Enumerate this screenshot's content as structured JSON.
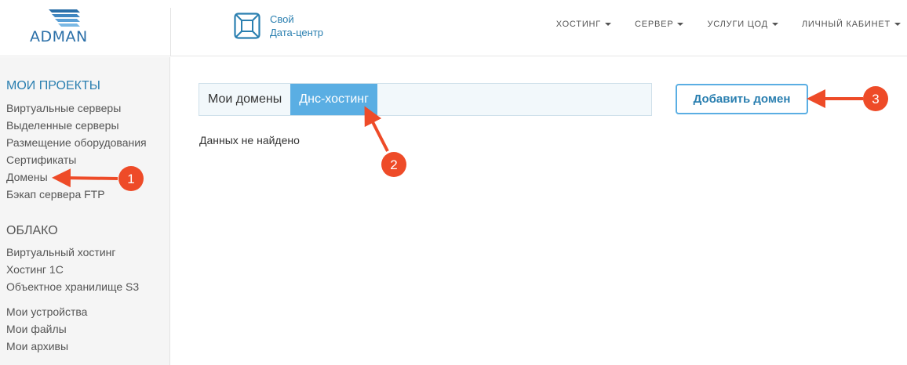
{
  "brand": {
    "logo_text": "ADMAN",
    "dc_line1": "Свой",
    "dc_line2": "Дата-центр"
  },
  "nav": [
    {
      "label": "ХОСТИНГ"
    },
    {
      "label": "СЕРВЕР"
    },
    {
      "label": "УСЛУГИ ЦОД"
    },
    {
      "label": "ЛИЧНЫЙ КАБИНЕТ"
    }
  ],
  "sidebar": {
    "projects_title": "МОИ ПРОЕКТЫ",
    "projects": [
      {
        "label": "Виртуальные серверы"
      },
      {
        "label": "Выделенные серверы"
      },
      {
        "label": "Размещение оборудования"
      },
      {
        "label": "Сертификаты"
      },
      {
        "label": "Домены"
      },
      {
        "label": "Бэкап сервера FTP"
      }
    ],
    "cloud_title": "ОБЛАКО",
    "cloud": [
      {
        "label": "Виртуальный хостинг"
      },
      {
        "label": "Хостинг 1С"
      },
      {
        "label": "Объектное хранилище S3"
      }
    ],
    "other": [
      {
        "label": "Мои устройства"
      },
      {
        "label": "Мои файлы"
      },
      {
        "label": "Мои архивы"
      }
    ]
  },
  "main": {
    "tabs": [
      {
        "label": "Мои домены",
        "active": false
      },
      {
        "label": "Днс-хостинг",
        "active": true
      }
    ],
    "add_button": "Добавить домен",
    "empty_text": "Данных не найдено"
  },
  "annotations": {
    "badges": [
      "1",
      "2",
      "3"
    ],
    "color": "#ee4b28"
  }
}
